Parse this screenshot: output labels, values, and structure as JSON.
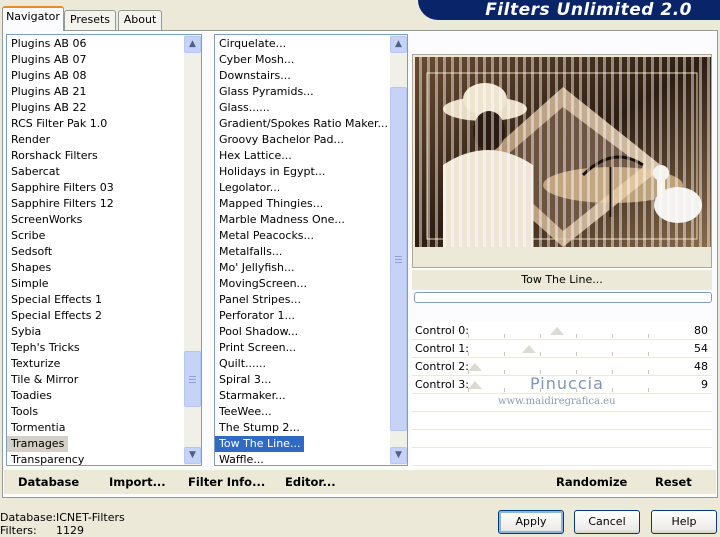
{
  "app": {
    "banner_title": "Filters Unlimited 2.0"
  },
  "tabs": [
    {
      "label": "Navigator",
      "active": true
    },
    {
      "label": "Presets",
      "active": false
    },
    {
      "label": "About",
      "active": false
    }
  ],
  "categories": {
    "items": [
      "Plugins AB 06",
      "Plugins AB 07",
      "Plugins AB 08",
      "Plugins AB 21",
      "Plugins AB 22",
      "RCS Filter Pak 1.0",
      "Render",
      "Rorshack Filters",
      "Sabercat",
      "Sapphire Filters 03",
      "Sapphire Filters 12",
      "ScreenWorks",
      "Scribe",
      "Sedsoft",
      "Shapes",
      "Simple",
      "Special Effects 1",
      "Special Effects 2",
      "Sybia",
      "Teph's Tricks",
      "Texturize",
      "Tile & Mirror",
      "Toadies",
      "Tools",
      "Tormentia",
      "Tramages",
      "Transparency"
    ],
    "selected": "Tramages"
  },
  "filters": {
    "items": [
      "Cirquelate...",
      "Cyber Mosh...",
      "Downstairs...",
      "Glass Pyramids...",
      "Glass......",
      "Gradient/Spokes Ratio Maker...",
      "Groovy Bachelor Pad...",
      "Hex Lattice...",
      "Holidays in Egypt...",
      "Legolator...",
      "Mapped Thingies...",
      "Marble Madness One...",
      "Metal Peacocks...",
      "Metalfalls...",
      "Mo' Jellyfish...",
      "MovingScreen...",
      "Panel Stripes...",
      "Perforator 1...",
      "Pool Shadow...",
      "Print Screen...",
      "Quilt......",
      "Spiral 3...",
      "Starmaker...",
      "TeeWee...",
      "The Stump 2...",
      "Tow The Line...",
      "Waffle..."
    ],
    "selected": "Tow The Line..."
  },
  "preview": {
    "filter_name": "Tow The Line..."
  },
  "controls": [
    {
      "label": "Control 0:",
      "value": 80
    },
    {
      "label": "Control 1:",
      "value": 54
    },
    {
      "label": "Control 2:",
      "value": 48
    },
    {
      "label": "Control 3:",
      "value": 9
    }
  ],
  "watermark": {
    "name": "Pinuccia",
    "site": "www.maidiregrafica.eu"
  },
  "bottom_links": {
    "database": "Database",
    "import": "Import...",
    "filter_info": "Filter Info...",
    "editor": "Editor...",
    "randomize": "Randomize",
    "reset": "Reset"
  },
  "status": {
    "database_label": "Database:",
    "database_value": "ICNET-Filters",
    "filters_label": "Filters:",
    "filters_value": "1129"
  },
  "buttons": {
    "apply": "Apply",
    "cancel": "Cancel",
    "help": "Help"
  },
  "colors": {
    "accent": "#0a246a",
    "selection": "#316ac5",
    "background": "#ece9d8"
  }
}
